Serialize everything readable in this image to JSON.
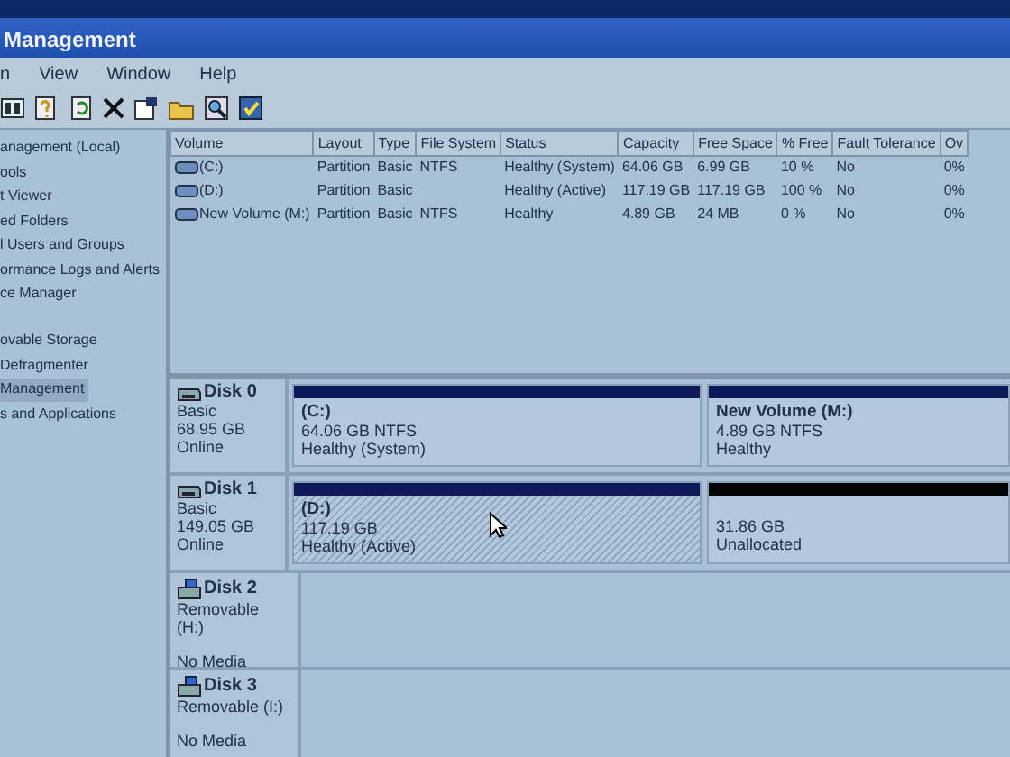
{
  "window": {
    "title": "Management"
  },
  "menu": [
    "n",
    "View",
    "Window",
    "Help"
  ],
  "sidebar": {
    "items": [
      {
        "label": "anagement (Local)",
        "selected": false
      },
      {
        "label": "ools",
        "selected": false
      },
      {
        "label": "t Viewer",
        "selected": false
      },
      {
        "label": "ed Folders",
        "selected": false
      },
      {
        "label": "l Users and Groups",
        "selected": false
      },
      {
        "label": "ormance Logs and Alerts",
        "selected": false
      },
      {
        "label": "ce Manager",
        "selected": false
      },
      {
        "label": "ovable Storage",
        "selected": false
      },
      {
        "label": "Defragmenter",
        "selected": false
      },
      {
        "label": "Management",
        "selected": true
      },
      {
        "label": "s and Applications",
        "selected": false
      }
    ]
  },
  "table": {
    "columns": [
      "Volume",
      "Layout",
      "Type",
      "File System",
      "Status",
      "Capacity",
      "Free Space",
      "% Free",
      "Fault Tolerance",
      "Ov"
    ],
    "rows": [
      [
        "(C:)",
        "Partition",
        "Basic",
        "NTFS",
        "Healthy (System)",
        "64.06 GB",
        "6.99 GB",
        "10 %",
        "No",
        "0%"
      ],
      [
        "(D:)",
        "Partition",
        "Basic",
        "",
        "Healthy (Active)",
        "117.19 GB",
        "117.19 GB",
        "100 %",
        "No",
        "0%"
      ],
      [
        "New Volume (M:)",
        "Partition",
        "Basic",
        "NTFS",
        "Healthy",
        "4.89 GB",
        "24 MB",
        "0 %",
        "No",
        "0%"
      ]
    ]
  },
  "disks": [
    {
      "name": "Disk 0",
      "kind": "basic",
      "lines": [
        "Basic",
        "68.95 GB",
        "Online"
      ],
      "partitions": [
        {
          "kind": "primary",
          "selected": false,
          "title": "(C:)",
          "lines": [
            "64.06 GB NTFS",
            "Healthy (System)"
          ]
        },
        {
          "kind": "primary",
          "selected": false,
          "title": "New Volume  (M:)",
          "lines": [
            "4.89 GB NTFS",
            "Healthy"
          ]
        }
      ]
    },
    {
      "name": "Disk 1",
      "kind": "basic",
      "lines": [
        "Basic",
        "149.05 GB",
        "Online"
      ],
      "partitions": [
        {
          "kind": "primary",
          "selected": true,
          "title": "(D:)",
          "lines": [
            "117.19 GB",
            "Healthy (Active)"
          ]
        },
        {
          "kind": "unallocated",
          "selected": false,
          "lines": [
            "31.86 GB",
            "Unallocated"
          ]
        }
      ]
    },
    {
      "name": "Disk 2",
      "kind": "removable",
      "lines": [
        "Removable (H:)",
        "No Media"
      ]
    },
    {
      "name": "Disk 3",
      "kind": "removable",
      "lines": [
        "Removable (I:)",
        "No Media"
      ]
    }
  ]
}
